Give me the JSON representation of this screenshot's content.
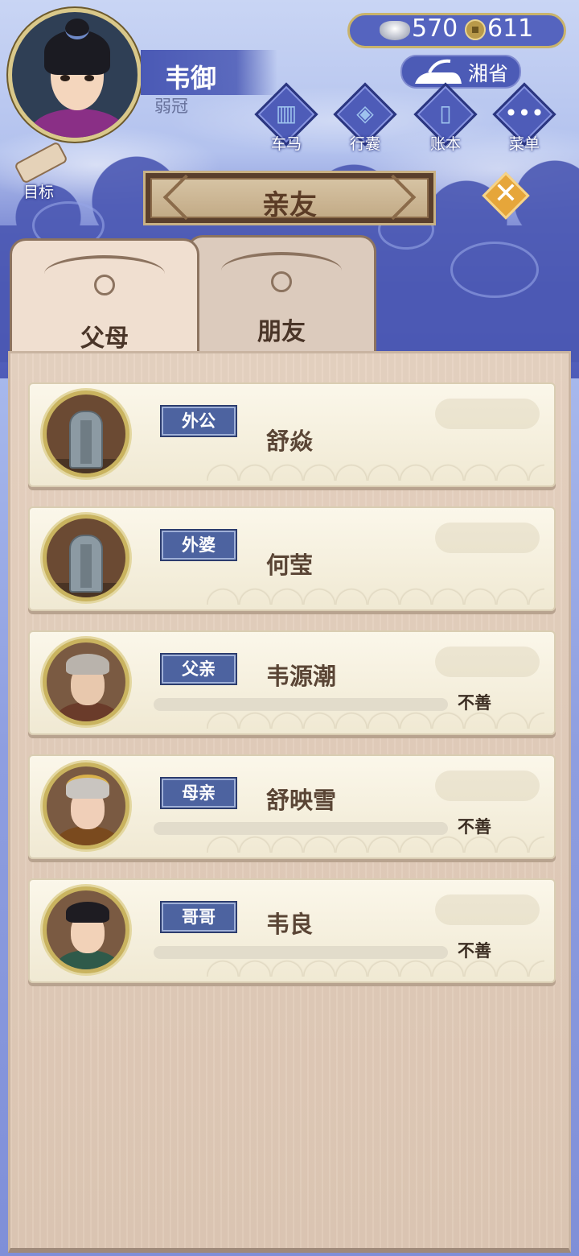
{
  "player": {
    "name": "韦御",
    "title": "弱冠"
  },
  "currency": {
    "silver": "570",
    "copper": "611"
  },
  "region": {
    "label": "湘省"
  },
  "menu": {
    "carriage": "车马",
    "bag": "行囊",
    "ledger": "账本",
    "menu": "菜单"
  },
  "goal": {
    "label": "目标"
  },
  "screen": {
    "title": "亲友"
  },
  "tabs": {
    "parents": "父母",
    "friends": "朋友"
  },
  "relatives": [
    {
      "relation": "外公",
      "name": "舒焱",
      "alive": false,
      "status": ""
    },
    {
      "relation": "外婆",
      "name": "何莹",
      "alive": false,
      "status": ""
    },
    {
      "relation": "父亲",
      "name": "韦源潮",
      "alive": true,
      "status": "不善"
    },
    {
      "relation": "母亲",
      "name": "舒映雪",
      "alive": true,
      "status": "不善"
    },
    {
      "relation": "哥哥",
      "name": "韦良",
      "alive": true,
      "status": "不善"
    }
  ],
  "colors": {
    "accent_blue": "#4d63a0",
    "gold": "#c9b35f",
    "close_orange": "#e6a63a"
  }
}
